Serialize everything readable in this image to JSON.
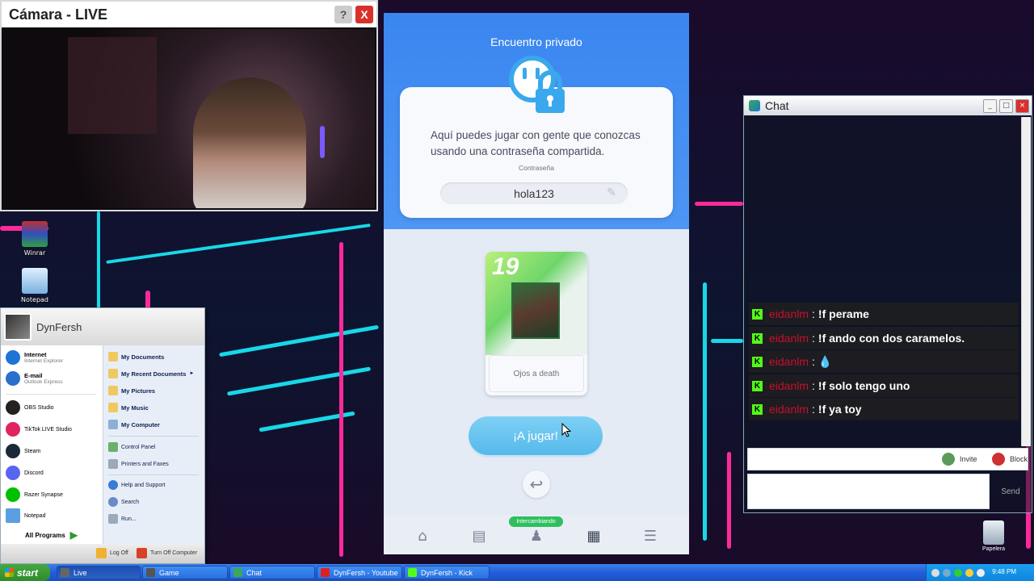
{
  "camera_window": {
    "title": "Cámara - LIVE",
    "help_label": "?",
    "close_label": "X"
  },
  "desktop_icons": [
    {
      "label": "Winrar",
      "icon": "winrar-icon"
    },
    {
      "label": "Notepad",
      "icon": "notepad-icon"
    }
  ],
  "game": {
    "heading": "Encuentro privado",
    "description": "Aquí puedes jugar con gente que conozcas usando una contraseña compartida.",
    "password_label": "Contraseña",
    "password_value": "hola123",
    "deck": {
      "number": "19",
      "name": "Ojos a death"
    },
    "play_button": "¡A jugar!",
    "nav_badge": "Intercambiando",
    "nav_icons": [
      "home-icon",
      "deck-icon",
      "trade-icon",
      "cards-icon",
      "menu-icon"
    ]
  },
  "start_menu": {
    "user": "DynFersh",
    "pinned": [
      {
        "main": "Internet",
        "sub": "Internet Explorer",
        "icon": "internet-explorer-icon",
        "color": "#1d74d6"
      },
      {
        "main": "E-mail",
        "sub": "Outlook Express",
        "icon": "outlook-icon",
        "color": "#2a6fc9"
      }
    ],
    "programs": [
      {
        "label": "OBS Studio",
        "icon": "obs-icon",
        "color": "#222222"
      },
      {
        "label": "TikTok LIVE Studio",
        "icon": "tiktok-icon",
        "color": "#e0245e"
      },
      {
        "label": "Steam",
        "icon": "steam-icon",
        "color": "#1b2838"
      },
      {
        "label": "Discord",
        "icon": "discord-icon",
        "color": "#5865f2"
      },
      {
        "label": "Razer Synapse",
        "icon": "razer-icon",
        "color": "#00c000"
      },
      {
        "label": "Notepad",
        "icon": "notepad-icon",
        "color": "#5aa0e0"
      }
    ],
    "all_programs": "All Programs",
    "right_items": [
      {
        "label": "My Documents",
        "bold": true,
        "icon": "folder-icon"
      },
      {
        "label": "My Recent Documents",
        "bold": true,
        "icon": "recent-docs-icon",
        "arrow": "►"
      },
      {
        "label": "My Pictures",
        "bold": true,
        "icon": "pictures-icon"
      },
      {
        "label": "My Music",
        "bold": true,
        "icon": "music-icon"
      },
      {
        "label": "My Computer",
        "bold": true,
        "icon": "computer-icon"
      },
      {
        "label": "Control Panel",
        "bold": false,
        "icon": "control-panel-icon"
      },
      {
        "label": "Printers and Faxes",
        "bold": false,
        "icon": "printer-icon"
      },
      {
        "label": "Help and Support",
        "bold": false,
        "icon": "help-icon"
      },
      {
        "label": "Search",
        "bold": false,
        "icon": "search-icon"
      },
      {
        "label": "Run...",
        "bold": false,
        "icon": "run-icon"
      }
    ],
    "log_off": "Log Off",
    "turn_off": "Turn Off Computer"
  },
  "chat_window": {
    "title": "Chat",
    "messages": [
      {
        "user": "eidanlm",
        "text": "!f perame"
      },
      {
        "user": "eidanlm",
        "text": "!f ando con dos caramelos."
      },
      {
        "user": "eidanlm",
        "text": "💧"
      },
      {
        "user": "eidanlm",
        "text": "!f solo tengo uno"
      },
      {
        "user": "eidanlm",
        "text": "!f ya toy"
      }
    ],
    "invite_label": "Invite",
    "block_label": "Block",
    "send_label": "Send"
  },
  "recycle_bin": {
    "label": "Papelera"
  },
  "taskbar": {
    "start_label": "start",
    "tasks": [
      {
        "label": "Live",
        "icon": "live-icon",
        "active": true
      },
      {
        "label": "Game",
        "icon": "game-icon",
        "active": false
      },
      {
        "label": "Chat",
        "icon": "chat-icon",
        "active": false
      },
      {
        "label": "DynFersh - Youtube",
        "icon": "youtube-icon",
        "active": false
      },
      {
        "label": "DynFersh - Kick",
        "icon": "kick-icon",
        "active": false
      }
    ],
    "clock": "9:48 PM"
  },
  "colors": {
    "game_blue": "#3a86f0",
    "play_button": "#55b9ec",
    "kick_green": "#53fc18",
    "chat_username": "#c8102e",
    "taskbar_blue": "#245ddb",
    "start_green": "#2f8b2c"
  }
}
